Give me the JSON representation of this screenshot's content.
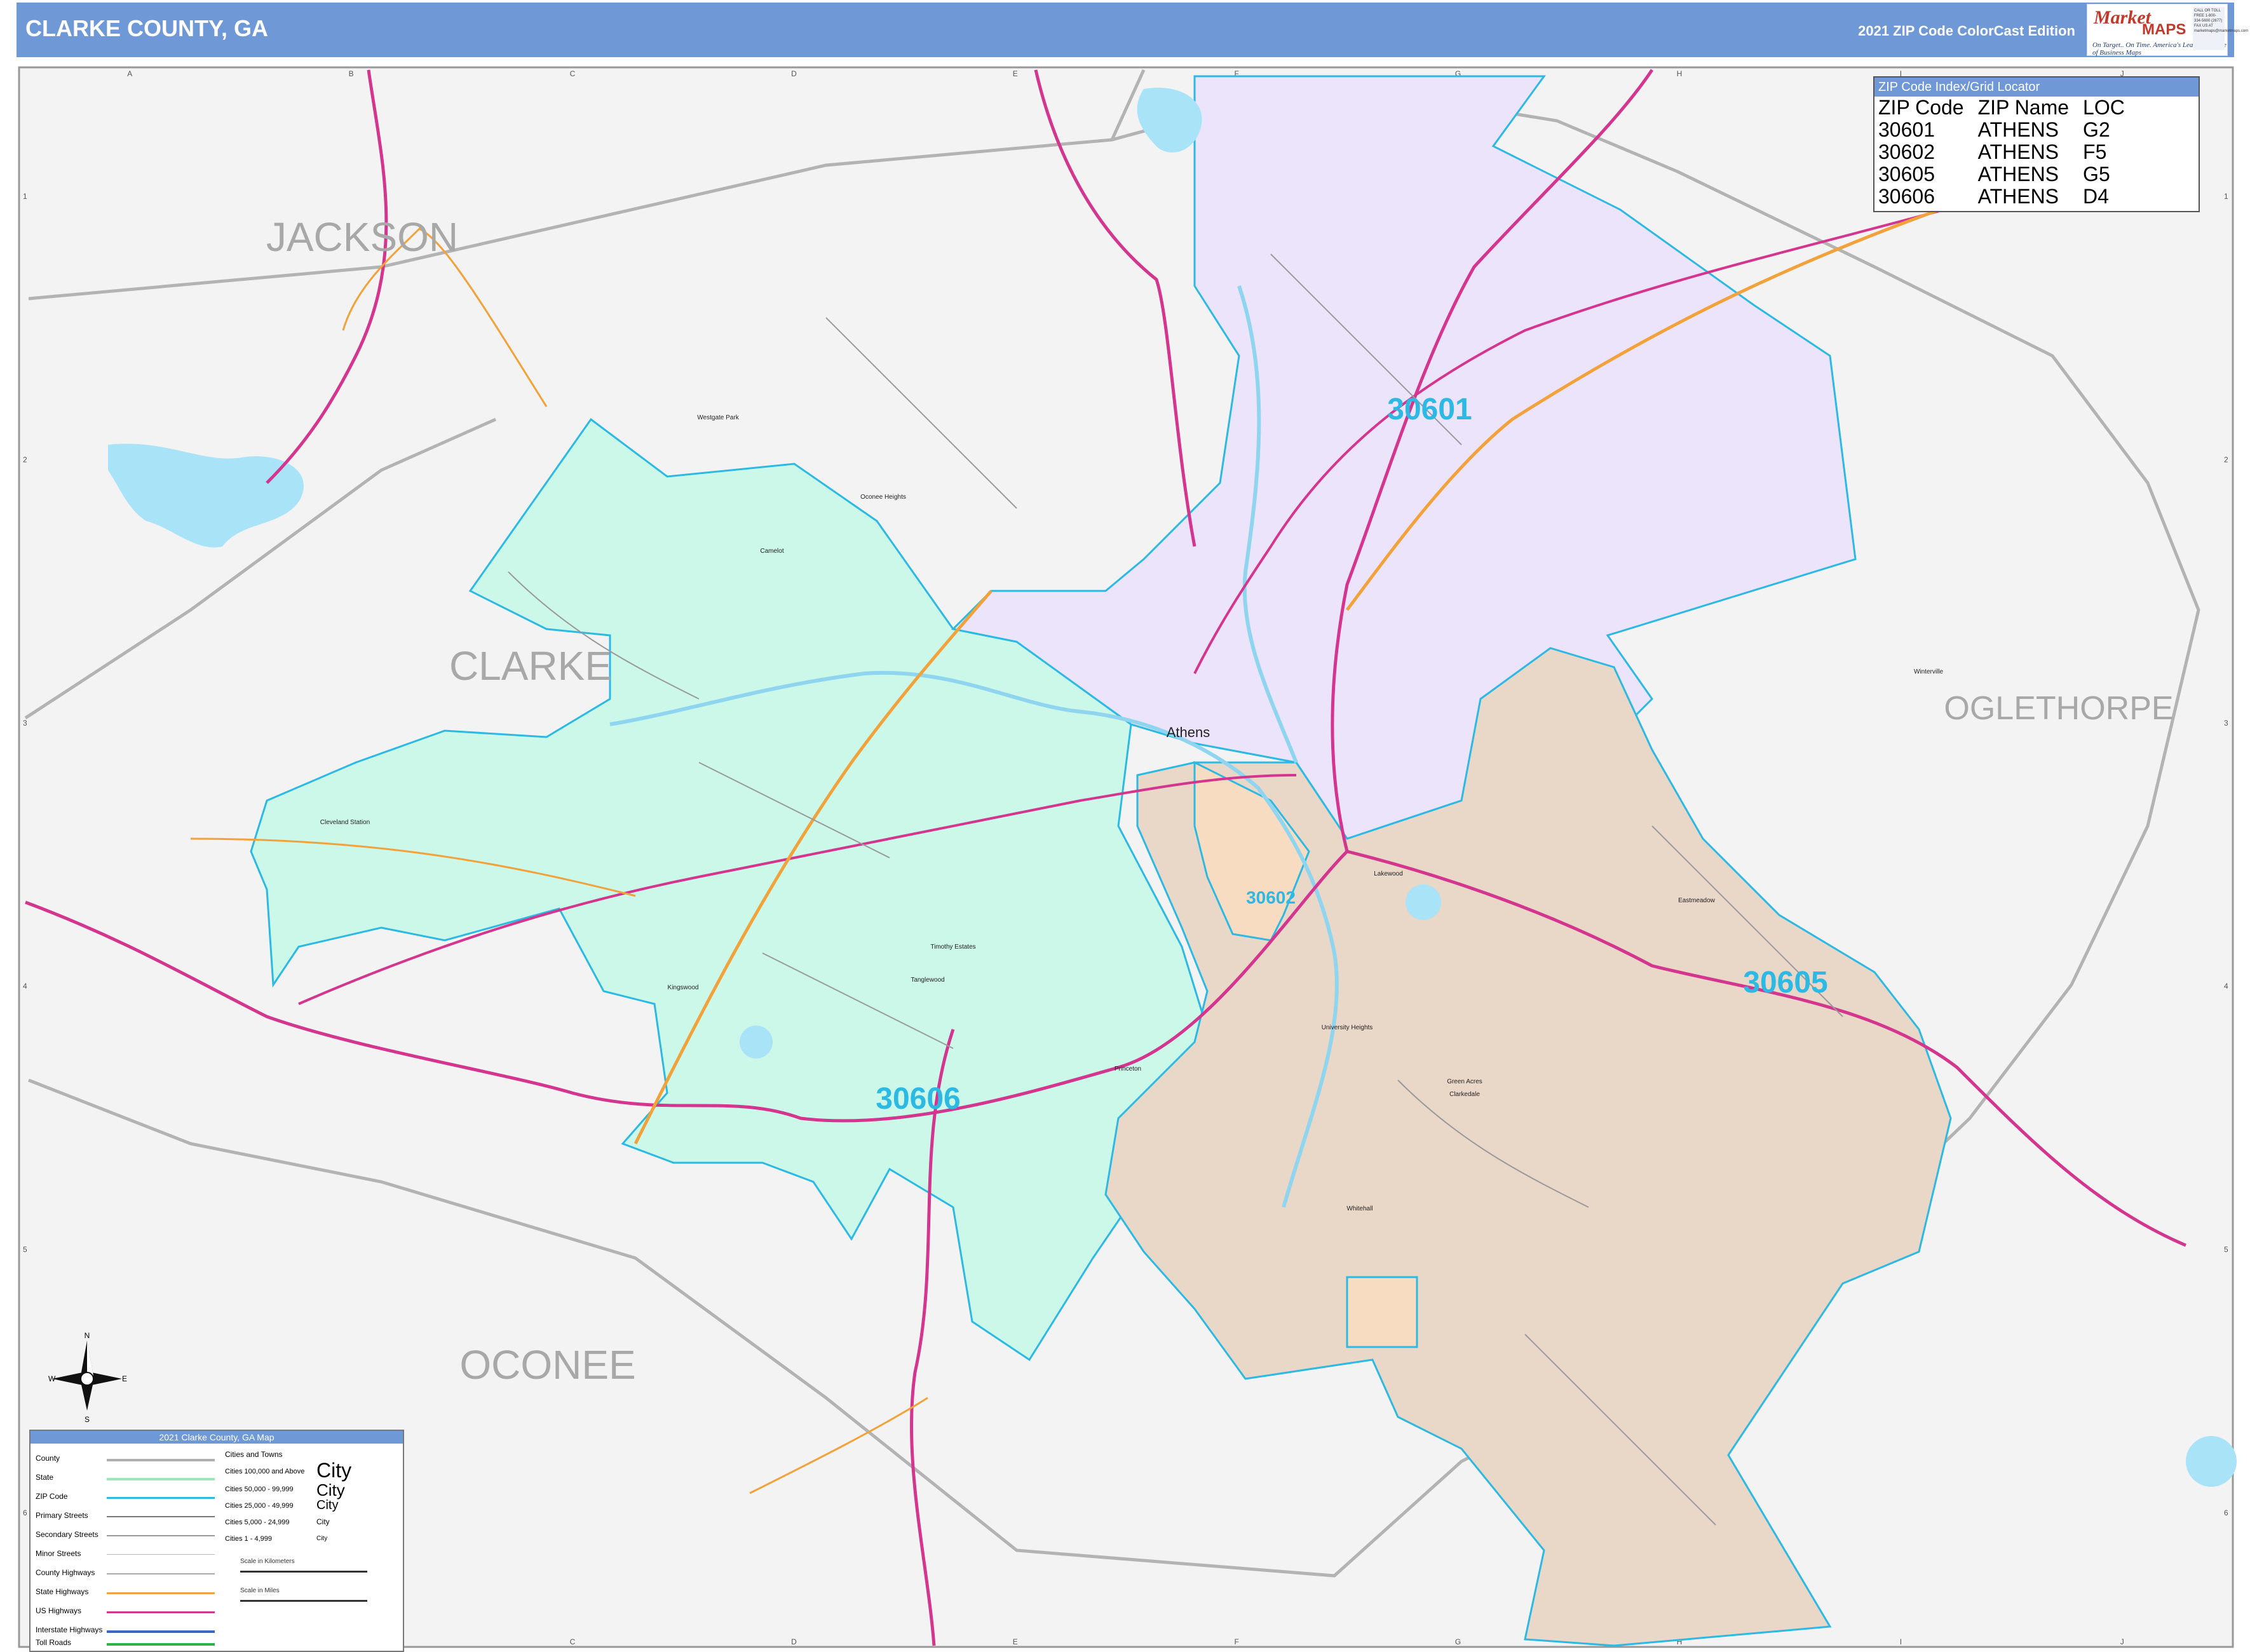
{
  "header": {
    "title": "CLARKE COUNTY, GA",
    "edition": "2021 ZIP Code ColorCast Edition"
  },
  "logo": {
    "brand_top": "Market",
    "brand_bottom": "MAPS",
    "tagline": "On Target.. On Time. America's Leading Source of Business Maps",
    "contact": "CALL OR TOLL FREE 1-800-334-5600 (2677) FAX US AT marketmaps@marketmaps.com"
  },
  "grid": {
    "columns": [
      "A",
      "B",
      "C",
      "D",
      "E",
      "F",
      "G",
      "H",
      "I",
      "J"
    ],
    "rows": [
      "1",
      "2",
      "3",
      "4",
      "5",
      "6"
    ]
  },
  "counties": {
    "jackson": "JACKSON",
    "clarke": "CLARKE",
    "oconee": "OCONEE",
    "oglethorpe": "OGLETHORPE"
  },
  "zip_labels": {
    "z30601": "30601",
    "z30602": "30602",
    "z30605": "30605",
    "z30606": "30606"
  },
  "zip_colors": {
    "30601": "#ece4fb",
    "30602": "#f8dcc2",
    "30605": "#e9d7c8",
    "30606": "#ccf8ea",
    "boundary": "#2cb9e3"
  },
  "places": {
    "athens": "Athens",
    "westgate_park": "Westgate Park",
    "oconee_heights": "Oconee Heights",
    "camelot": "Camelot",
    "cleveland_station": "Cleveland Station",
    "timothy_estates": "Timothy Estates",
    "tanglewood": "Tanglewood",
    "kingswood": "Kingswood",
    "princeton": "Princeton",
    "lakewood": "Lakewood",
    "eastmeadow": "Eastmeadow",
    "university_heights": "University Heights",
    "green_acres": "Green Acres",
    "clarkedale": "Clarkedale",
    "whitehall": "Whitehall",
    "winterville": "Winterville"
  },
  "zip_index": {
    "title": "ZIP Code Index/Grid Locator",
    "headers": [
      "ZIP Code",
      "ZIP Name",
      "LOC"
    ],
    "rows": [
      [
        "30601",
        "ATHENS",
        "G2"
      ],
      [
        "30602",
        "ATHENS",
        "F5"
      ],
      [
        "30605",
        "ATHENS",
        "G5"
      ],
      [
        "30606",
        "ATHENS",
        "D4"
      ]
    ]
  },
  "legend": {
    "title": "2021 Clarke County, GA Map",
    "items": [
      "County",
      "State",
      "ZIP Code",
      "Primary Streets",
      "Secondary Streets",
      "Minor Streets",
      "County Highways",
      "State Highways",
      "US Highways",
      "Interstate Highways",
      "Toll Roads"
    ],
    "cities_title": "Cities and Towns",
    "city_classes": [
      "Cities 100,000 and Above",
      "Cities 50,000 - 99,999",
      "Cities 25,000 - 49,999",
      "Cities 5,000 - 24,999",
      "Cities 1 - 4,999"
    ],
    "city_sample": "City",
    "scale_km": "Scale in Kilometers",
    "scale_mi": "Scale in Miles"
  },
  "compass": {
    "n": "N",
    "s": "S",
    "e": "E",
    "w": "W"
  },
  "colors": {
    "header": "#6f98d6",
    "us_highway": "#d4358e",
    "state_highway": "#f2a23a",
    "interstate": "#3a66c4",
    "water": "#a9e3f7",
    "county_line": "#b0b0b0"
  }
}
